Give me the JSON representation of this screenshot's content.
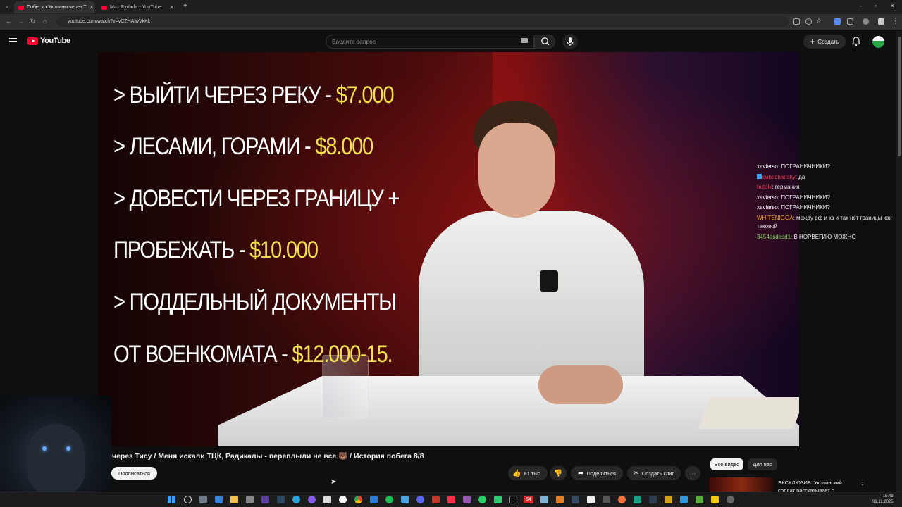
{
  "browser": {
    "tabs": [
      {
        "title": "Побег из Украины через Т",
        "active": true
      },
      {
        "title": "Max Rydada - YouTube",
        "active": false
      }
    ],
    "new_tab": "+",
    "url": "youtube.com/watch?v=vCZHAlwVkKk",
    "window_controls": [
      "–",
      "▫",
      "✕"
    ]
  },
  "youtube": {
    "logo_text": "YouTube",
    "search_placeholder": "Введите запрос",
    "create_label": "Создать",
    "icons": [
      "menu-icon",
      "search-icon",
      "mic-icon",
      "keyboard-icon",
      "bell-icon"
    ]
  },
  "video": {
    "overlay_lines": [
      {
        "text": "> ВЫЙТИ ЧЕРЕЗ РЕКУ - ",
        "price": "$7.000"
      },
      {
        "text": "> ЛЕСАМИ, ГОРАМИ - ",
        "price": "$8.000"
      },
      {
        "text": "> ДОВЕСТИ ЧЕРЕЗ ГРАНИЦУ +",
        "price": ""
      },
      {
        "text": "ПРОБЕЖАТЬ - ",
        "price": "$10.000"
      },
      {
        "text": "> ПОДДЕЛЬНЫЙ ДОКУМЕНТЫ",
        "price": ""
      },
      {
        "text": "ОТ ВОЕНКОМАТА - ",
        "price": "$12.000-15."
      }
    ],
    "title": "через Тису / Меня искали ТЦК, Радикалы - переплыли не все 🐻 / История побега 8/8",
    "subscribe_label": "Подписаться",
    "likes": "81 тыс.",
    "share_label": "Поделиться",
    "clip_label": "Создать клип",
    "more_label": "···"
  },
  "chat": [
    {
      "user": "xavierso",
      "color": "#ffffff",
      "text": "ПОГРАНИЧНИКИ?"
    },
    {
      "user": "cubechansky",
      "color": "#e8384f",
      "text": "да"
    },
    {
      "user": "butolk",
      "color": "#e8384f",
      "text": "германия"
    },
    {
      "user": "xavierso",
      "color": "#ffffff",
      "text": "ПОГРАНИЧНИКИ?"
    },
    {
      "user": "xavierso",
      "color": "#ffffff",
      "text": "ПОГРАНИЧНИКИ?"
    },
    {
      "user": "WHITENIGGA",
      "color": "#f5a623",
      "text": "между рф и кз и так нет границы как таковой"
    },
    {
      "user": "3454asdasd1",
      "color": "#7ed957",
      "text": "В НОРВЕГИЮ МОЖНО"
    }
  ],
  "sidebar": {
    "chips": [
      "Все видео",
      "Для вас"
    ],
    "recommendation_title": "ЭКСКЛЮЗИВ. Украинский солдат рассказывает о"
  },
  "taskbar": {
    "time": "15:49",
    "date": "01.11.2025",
    "badge": "64"
  },
  "colors": {
    "price_yellow": "#f3e04b",
    "yt_red": "#ff0033",
    "bg": "#0f0f0f"
  }
}
